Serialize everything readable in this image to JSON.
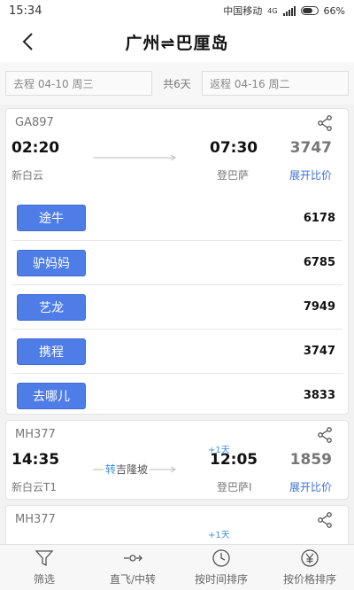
{
  "status": {
    "time": "15:34",
    "carrier": "中国移动",
    "network": "4G",
    "battery": "66%"
  },
  "header": {
    "title": "广州⇌巴厘岛"
  },
  "dates": {
    "outbound": "去程 04-10 周三",
    "duration": "共6天",
    "return": "返程 04-16 周二"
  },
  "flights": [
    {
      "flight_no": "GA897",
      "dep_time": "02:20",
      "arr_time": "07:30",
      "price": "3747",
      "dep_airport": "新白云",
      "arr_airport": "登巴萨",
      "compare_label": "展开比价",
      "agents": [
        {
          "name": "途牛",
          "price": "6178"
        },
        {
          "name": "驴妈妈",
          "price": "6785"
        },
        {
          "name": "艺龙",
          "price": "7949"
        },
        {
          "name": "携程",
          "price": "3747"
        },
        {
          "name": "去哪儿",
          "price": "3833"
        }
      ]
    },
    {
      "flight_no": "MH377",
      "dep_time": "14:35",
      "arr_time": "12:05",
      "price": "1859",
      "dep_airport": "新白云T1",
      "arr_airport": "登巴萨I",
      "compare_label": "展开比价",
      "day_offset": "+1天",
      "transfer_mark": "转",
      "transfer_city": "吉隆坡"
    },
    {
      "flight_no": "MH377",
      "day_offset": "+1天"
    }
  ],
  "bottom_nav": [
    {
      "label": "筛选",
      "icon": "filter-icon"
    },
    {
      "label": "直飞/中转",
      "icon": "route-icon"
    },
    {
      "label": "按时间排序",
      "icon": "clock-icon"
    },
    {
      "label": "按价格排序",
      "icon": "yen-icon"
    }
  ],
  "colors": {
    "accent": "#4f7de8",
    "link": "#3b6fd9",
    "offset": "#3b8fe0"
  }
}
